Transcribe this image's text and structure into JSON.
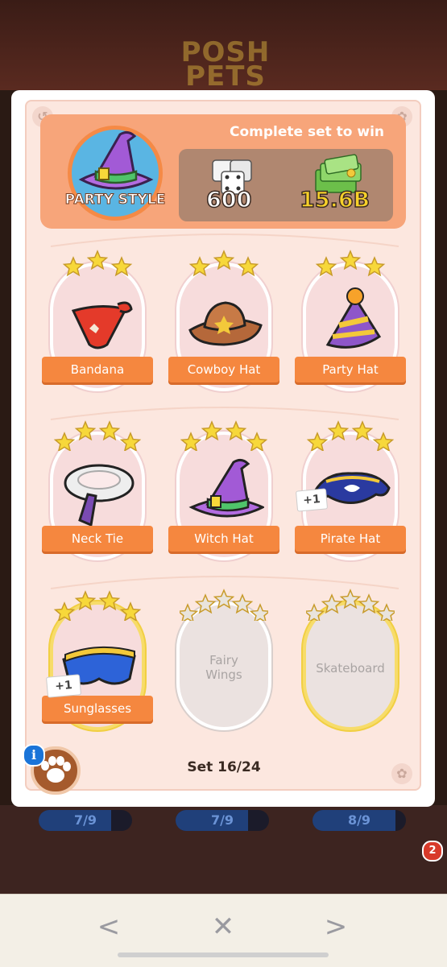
{
  "background": {
    "logo_text": "POSH\nPETS",
    "progress_pills": [
      {
        "label": "7/9",
        "fill": 0.78
      },
      {
        "label": "7/9",
        "fill": 0.78
      },
      {
        "label": "8/9",
        "fill": 0.89
      }
    ],
    "notification_count": "2"
  },
  "header": {
    "title": "Complete set to win",
    "set_name": "PARTY STYLE",
    "reward_dice": "600",
    "reward_cash": "15.6B",
    "accent": "#f7a57a"
  },
  "stickers": [
    {
      "name": "Bandana",
      "stars": 3,
      "state": "collected",
      "art": "bandana",
      "dupes": ""
    },
    {
      "name": "Cowboy Hat",
      "stars": 3,
      "state": "collected",
      "art": "cowboy-hat",
      "dupes": ""
    },
    {
      "name": "Party Hat",
      "stars": 3,
      "state": "collected",
      "art": "party-hat",
      "dupes": ""
    },
    {
      "name": "Neck Tie",
      "stars": 4,
      "state": "collected",
      "art": "neck-tie",
      "dupes": ""
    },
    {
      "name": "Witch Hat",
      "stars": 4,
      "state": "collected",
      "art": "witch-hat",
      "dupes": ""
    },
    {
      "name": "Pirate Hat",
      "stars": 4,
      "state": "collected",
      "art": "pirate-hat",
      "dupes": "+1"
    },
    {
      "name": "Sunglasses",
      "stars": 4,
      "state": "collected-gold",
      "art": "sunglasses",
      "dupes": "+1"
    },
    {
      "name": "Fairy Wings",
      "stars": 5,
      "state": "locked",
      "art": "",
      "dupes": ""
    },
    {
      "name": "Skateboard",
      "stars": 5,
      "state": "locked-gold",
      "art": "",
      "dupes": ""
    }
  ],
  "footer": {
    "set_counter": "Set 16/24",
    "info": "i"
  },
  "navbar": {
    "back": "<",
    "close": "✕",
    "forward": ">"
  },
  "colors": {
    "star_gold": "#f7d83a",
    "star_silver": "#e9e4dc",
    "label_orange": "#f5873f"
  }
}
